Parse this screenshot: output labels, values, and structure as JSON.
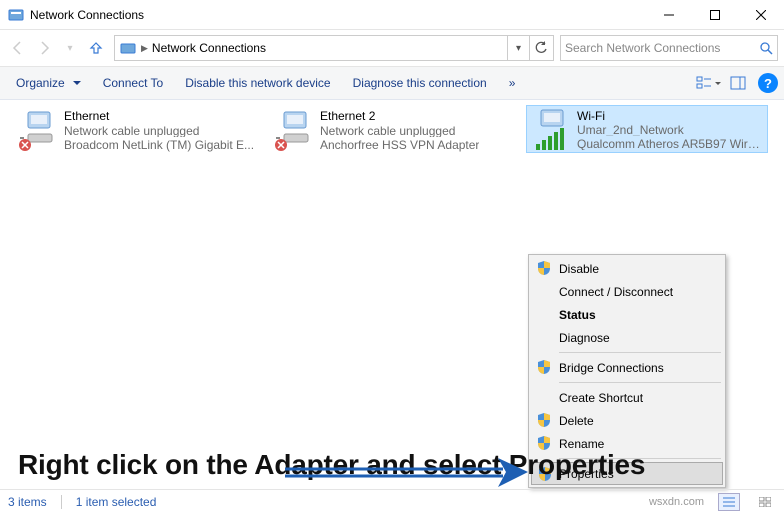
{
  "window": {
    "title": "Network Connections"
  },
  "nav": {
    "breadcrumb": "Network Connections"
  },
  "search": {
    "placeholder": "Search Network Connections"
  },
  "cmdbar": {
    "organize": "Organize",
    "connect": "Connect To",
    "disable": "Disable this network device",
    "diagnose": "Diagnose this connection",
    "overflow": "»"
  },
  "adapters": [
    {
      "name": "Ethernet",
      "status": "Network cable unplugged",
      "device": "Broadcom NetLink (TM) Gigabit E..."
    },
    {
      "name": "Ethernet 2",
      "status": "Network cable unplugged",
      "device": "Anchorfree HSS VPN Adapter"
    },
    {
      "name": "Wi-Fi",
      "status": "Umar_2nd_Network",
      "device": "Qualcomm Atheros AR5B97 Wirel..."
    }
  ],
  "ctx": {
    "disable": "Disable",
    "connect": "Connect / Disconnect",
    "status": "Status",
    "diagnose": "Diagnose",
    "bridge": "Bridge Connections",
    "shortcut": "Create Shortcut",
    "delete": "Delete",
    "rename": "Rename",
    "properties": "Properties"
  },
  "annotation": "Right click on the Adapter and select Properties",
  "statusbar": {
    "count": "3 items",
    "selected": "1 item selected",
    "watermark": "wsxdn.com"
  }
}
